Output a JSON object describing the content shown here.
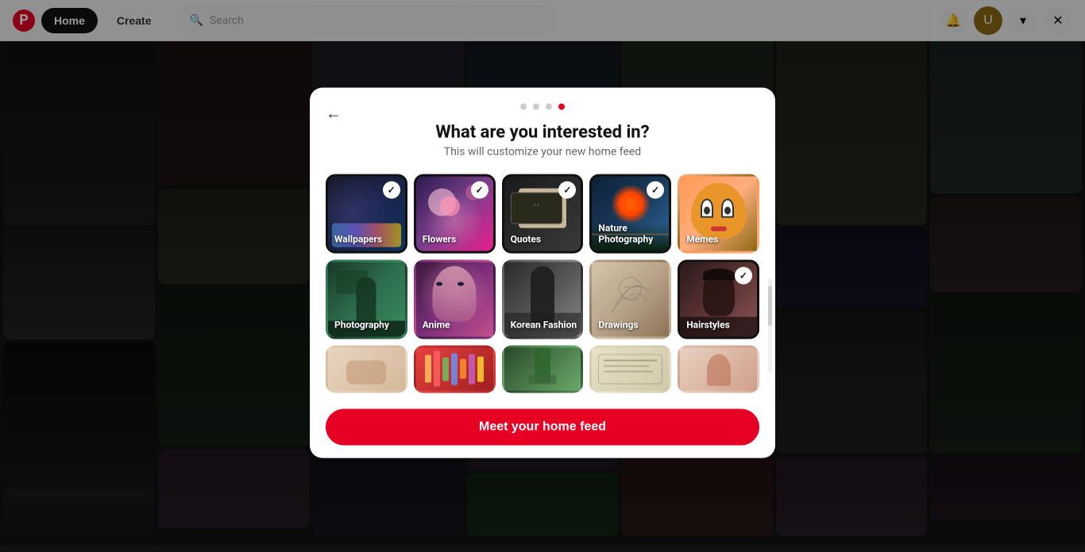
{
  "topnav": {
    "logo_text": "P",
    "home_label": "Home",
    "create_label": "Create",
    "search_placeholder": "Search"
  },
  "modal": {
    "step_dots": [
      {
        "active": false
      },
      {
        "active": false
      },
      {
        "active": false
      },
      {
        "active": true
      }
    ],
    "title": "What are you interested in?",
    "subtitle": "This will customize your new home feed",
    "back_label": "←",
    "cta_label": "Meet your home feed",
    "categories": [
      {
        "id": "wallpapers",
        "label": "Wallpapers",
        "selected": true,
        "style": "cat-wallpapers"
      },
      {
        "id": "flowers",
        "label": "Flowers",
        "selected": true,
        "style": "cat-flowers"
      },
      {
        "id": "quotes",
        "label": "Quotes",
        "selected": true,
        "style": "cat-quotes"
      },
      {
        "id": "nature",
        "label": "Nature Photography",
        "selected": true,
        "style": "cat-nature"
      },
      {
        "id": "memes",
        "label": "Memes",
        "selected": false,
        "style": "cat-memes"
      },
      {
        "id": "photography",
        "label": "Photography",
        "selected": false,
        "style": "cat-photography"
      },
      {
        "id": "anime",
        "label": "Anime",
        "selected": false,
        "style": "cat-anime"
      },
      {
        "id": "korean-fashion",
        "label": "Korean Fashion",
        "selected": false,
        "style": "cat-korean-fashion"
      },
      {
        "id": "drawings",
        "label": "Drawings",
        "selected": false,
        "style": "cat-drawings"
      },
      {
        "id": "hairstyles",
        "label": "Hairstyles",
        "selected": true,
        "style": "cat-hairstyles"
      },
      {
        "id": "partial1",
        "label": "",
        "selected": false,
        "style": "cat-partial1"
      },
      {
        "id": "partial2",
        "label": "",
        "selected": false,
        "style": "cat-partial2"
      },
      {
        "id": "partial3",
        "label": "",
        "selected": false,
        "style": "cat-partial3"
      },
      {
        "id": "partial4",
        "label": "",
        "selected": false,
        "style": "cat-partial4"
      },
      {
        "id": "partial5",
        "label": "",
        "selected": false,
        "style": "cat-partial5"
      }
    ]
  },
  "background": {
    "columns": 7,
    "colors": [
      "#3a3a3a",
      "#4a4a4a",
      "#555",
      "#3d3d3d",
      "#4a4a4a",
      "#3a3a3a",
      "#555"
    ]
  }
}
